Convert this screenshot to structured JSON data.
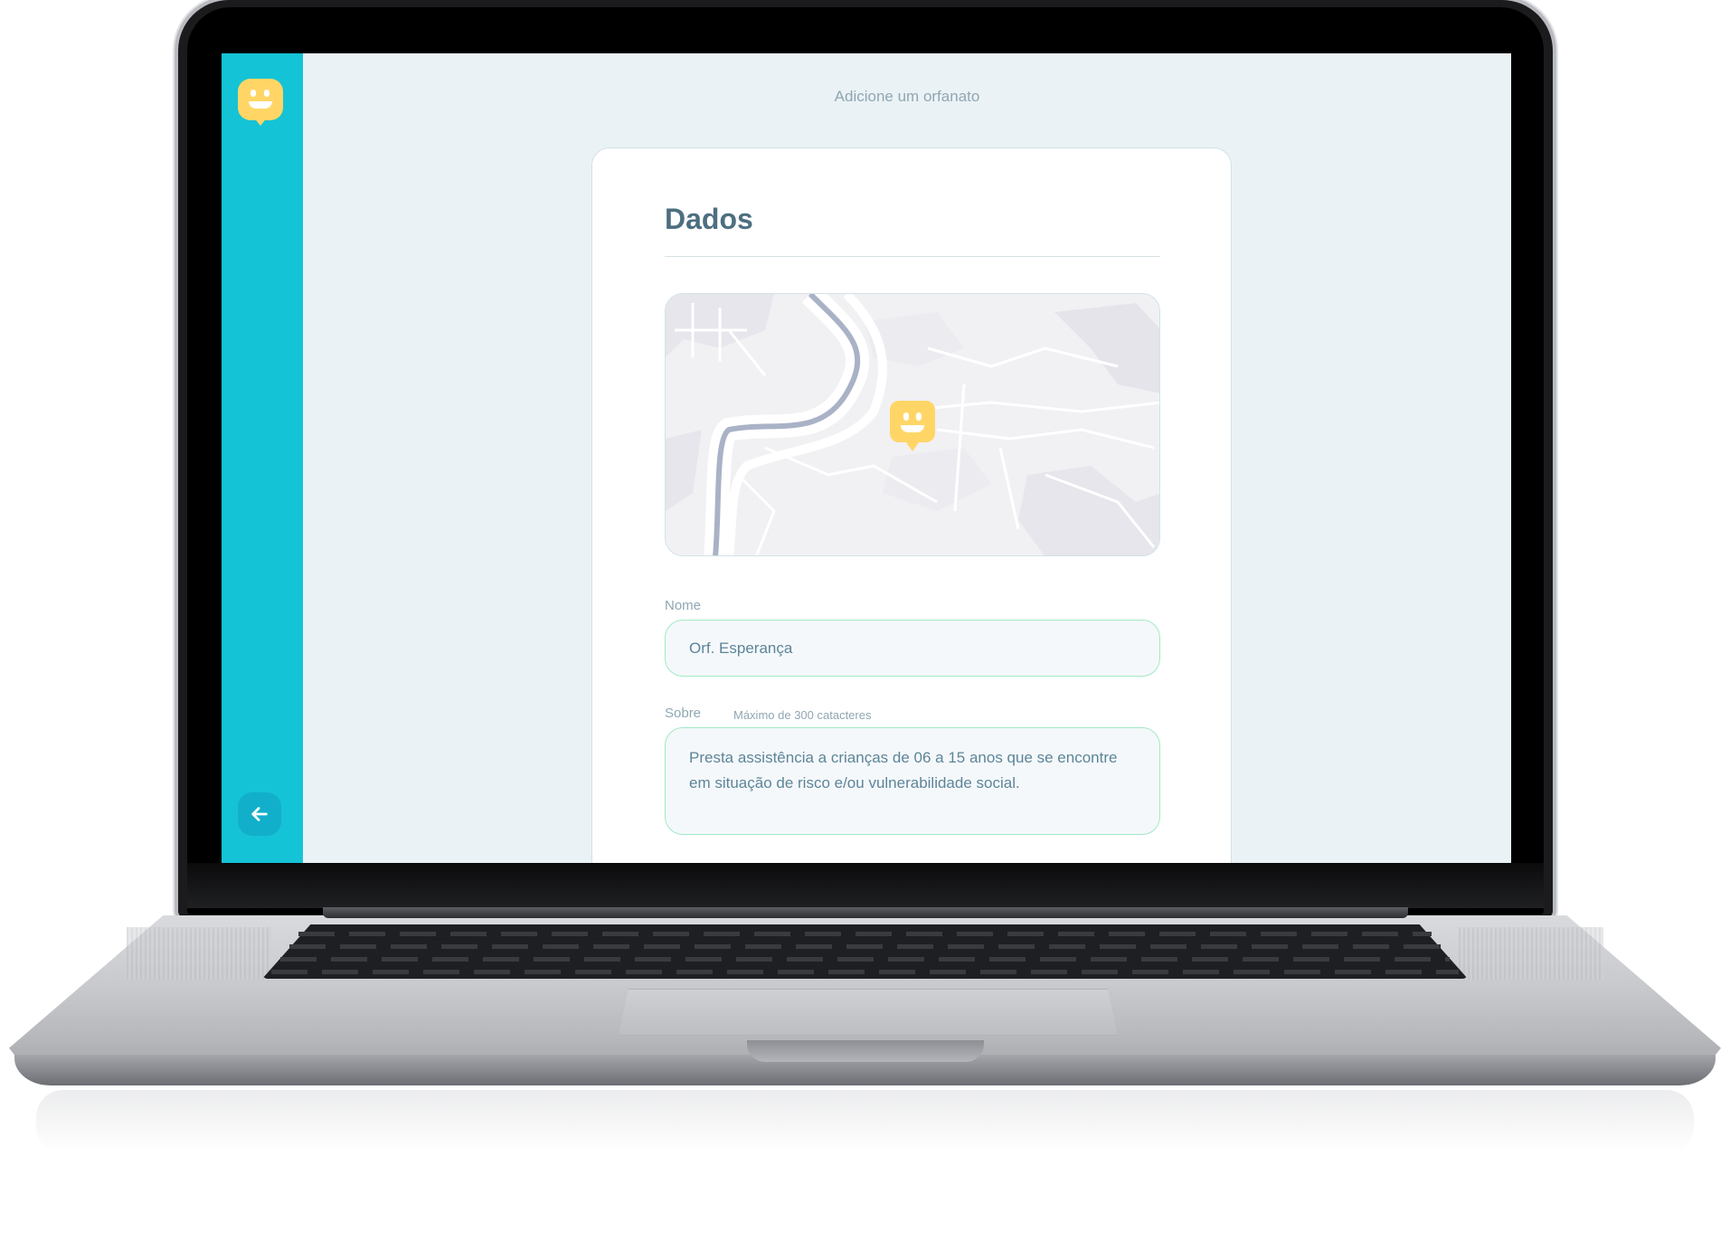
{
  "page": {
    "header_title": "Adicione um orfanato"
  },
  "sidebar": {
    "logo_icon": "happy-face-marker-icon",
    "back_icon": "arrow-left-icon"
  },
  "form": {
    "section_title": "Dados",
    "map": {
      "marker_icon": "happy-face-marker-icon"
    },
    "name_label": "Nome",
    "name_value": "Orf. Esperança",
    "about_label": "Sobre",
    "about_hint": "Máximo de 300 catacteres",
    "about_value": "Presta assistência a crianças de 06 a 15 anos que se encontre em situação de risco e/ou vulnerabilidade social."
  },
  "colors": {
    "sidebar": "#15c3d6",
    "logo": "#ffd666",
    "back_button": "#12afcb",
    "background": "#ebf2f5",
    "title_text": "#4d6f80",
    "input_border": "#a1e9c5"
  }
}
